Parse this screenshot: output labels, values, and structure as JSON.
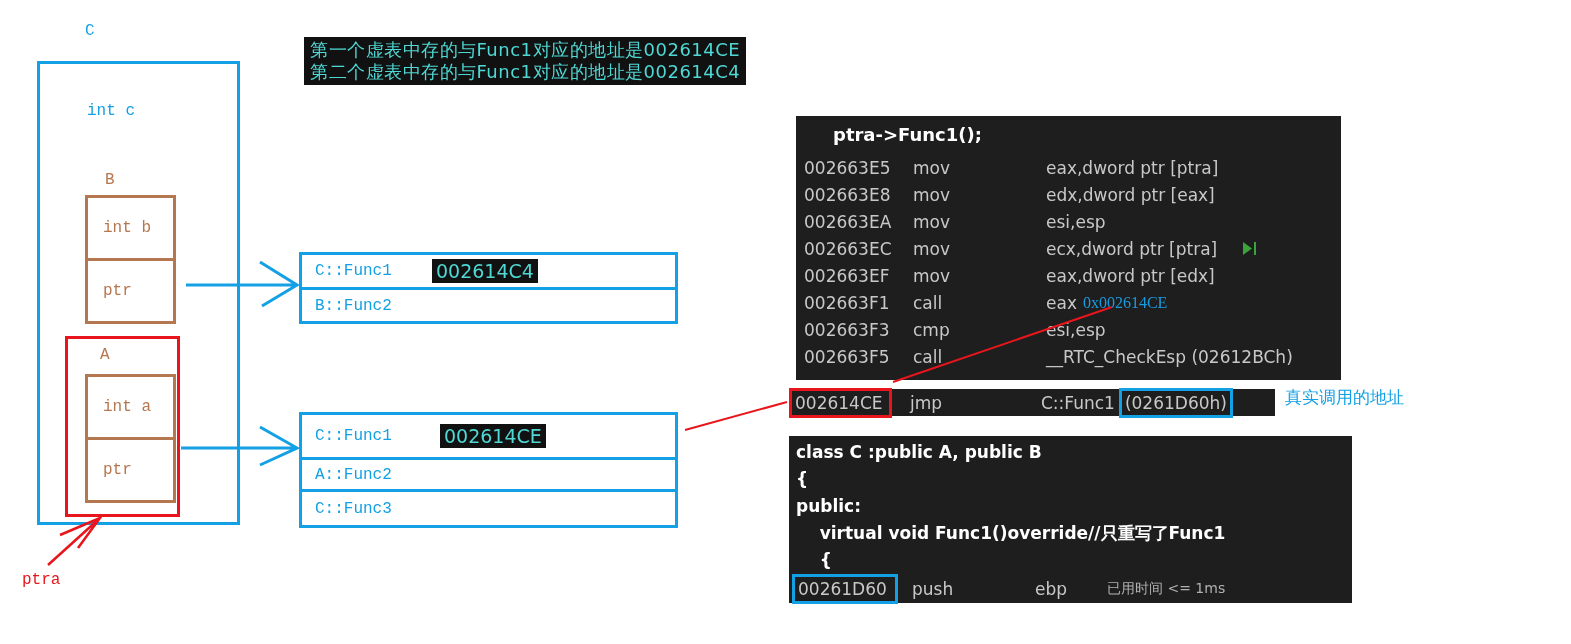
{
  "notes": [
    "第一个虚表中存的与Func1对应的地址是002614CE",
    "第二个虚表中存的与Func1对应的地址是002614C4"
  ],
  "object": {
    "name": "C",
    "member": "int c",
    "bases": [
      {
        "name": "B",
        "fields": [
          "int b",
          "ptr"
        ],
        "highlighted": false
      },
      {
        "name": "A",
        "fields": [
          "int a",
          "ptr"
        ],
        "highlighted": true
      }
    ]
  },
  "pointer_label": "ptra",
  "vtables": [
    {
      "entries": [
        {
          "name": "C::Func1",
          "address": "002614C4"
        },
        {
          "name": "B::Func2"
        }
      ]
    },
    {
      "entries": [
        {
          "name": "C::Func1",
          "address": "002614CE"
        },
        {
          "name": "A::Func2"
        },
        {
          "name": "C::Func3"
        }
      ]
    }
  ],
  "disassembly": {
    "header": "ptra->Func1();",
    "rows": [
      {
        "address": "002663E5",
        "op": "mov",
        "operand": "eax,dword ptr [ptra]",
        "marker": false
      },
      {
        "address": "002663E8",
        "op": "mov",
        "operand": "edx,dword ptr [eax]",
        "marker": false
      },
      {
        "address": "002663EA",
        "op": "mov",
        "operand": "esi,esp",
        "marker": false
      },
      {
        "address": "002663EC",
        "op": "mov",
        "operand": "ecx,dword ptr [ptra]",
        "marker": true
      },
      {
        "address": "002663EF",
        "op": "mov",
        "operand": "eax,dword ptr [edx]",
        "marker": false
      },
      {
        "address": "002663F1",
        "op": "call",
        "operand": "eax",
        "annotation": "0x002614CE",
        "marker": false
      },
      {
        "address": "002663F3",
        "op": "cmp",
        "operand": "esi,esp",
        "marker": false
      },
      {
        "address": "002663F5",
        "op": "call",
        "operand": "__RTC_CheckEsp (02612BCh)",
        "marker": false
      }
    ]
  },
  "jump": {
    "address": "002614CE",
    "op": "jmp",
    "target": "C::Func1",
    "destination": "(0261D60h)",
    "note": "真实调用的地址"
  },
  "source": {
    "lines": [
      "class C :public A, public B",
      "{",
      "public:",
      "    virtual void Func1()override//只重写了Func1",
      "    {"
    ],
    "final_row": {
      "address": "00261D60",
      "op": "push",
      "operand": "ebp",
      "timing": "已用时间 <= 1ms"
    }
  }
}
